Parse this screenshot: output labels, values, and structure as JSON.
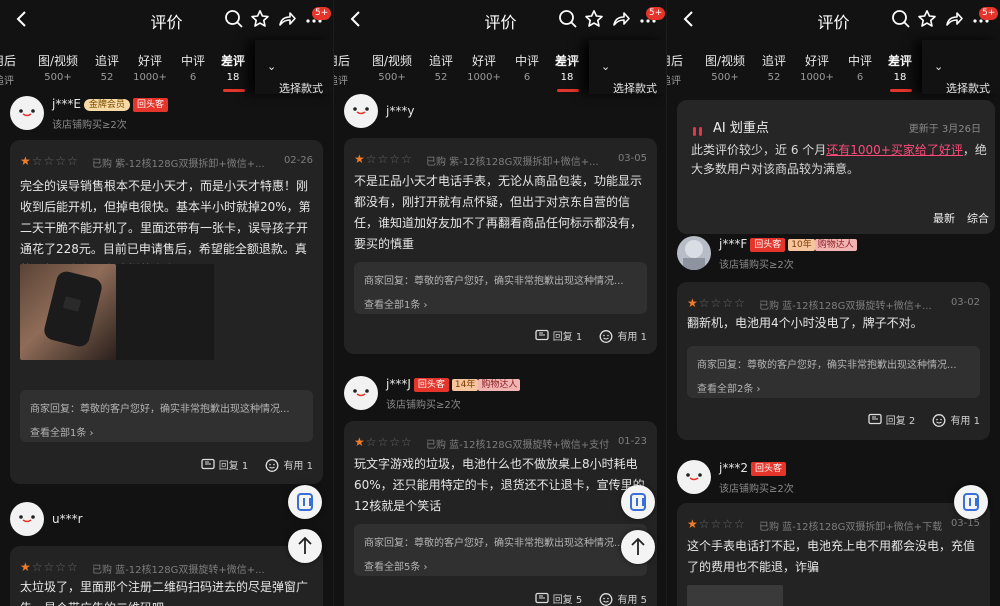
{
  "header": {
    "title": "评价",
    "badge": "5+"
  },
  "tabs": [
    {
      "label": "用后",
      "count": "追评"
    },
    {
      "label": "图/视频",
      "count": "500+"
    },
    {
      "label": "追评",
      "count": "52"
    },
    {
      "label": "好评",
      "count": "1000+"
    },
    {
      "label": "中评",
      "count": "6"
    },
    {
      "label": "差评",
      "count": "18"
    }
  ],
  "style_select": "选择款式",
  "common": {
    "merchant_reply": "商家回复：尊敬的客户您好，确实非常抱歉出现这种情况...",
    "reply_label": "回复",
    "useful_label": "有用"
  },
  "panel1": {
    "top_user": {
      "name": "j***E",
      "gold_tag": "金牌会员",
      "repeat_tag": "回头客",
      "meta": "该店铺购买≥2次"
    },
    "review": {
      "bought": "已购 紫-12核128G双摄拆卸+微信+...",
      "date": "02-26",
      "text": "完全的误导销售根本不是小天才，而是小天才特惠！刚收到后能开机，但掉电很快。基本半小时就掉20%，第二天干脆不能开机了。里面还带有一张卡，误导孩子开通花了228元。目前已申请售后，希望能全额退款。真的没想到京东还有这样的商家",
      "view_all": "查看全部1条",
      "reply_count": "1",
      "useful_count": "1"
    },
    "user2": {
      "name": "u***r"
    },
    "review2": {
      "bought": "已购 蓝-12核128G双摄旋转+微信+...",
      "date": "",
      "text": "太垃圾了，里面那个注册二维码扫码进去的尽是弹窗广告，是个带广告的二维码吧"
    }
  },
  "panel2": {
    "top_user": {
      "name": "j***y"
    },
    "review": {
      "bought": "已购 紫-12核128G双摄拆卸+微信+...",
      "date": "03-05",
      "text": "不是正品小天才电话手表，无论从商品包装，功能显示都没有，刚打开就有点怀疑，但出于对京东自营的信任，谁知道加好友加不了再翻看商品任何标示都没有，要买的慎重",
      "view_all": "查看全部1条",
      "reply_count": "1",
      "useful_count": "1"
    },
    "user2": {
      "name": "j***J",
      "repeat_tag": "回头客",
      "year_tag": "14年",
      "buyer_tag": "购物达人",
      "meta": "该店铺购买≥2次"
    },
    "review2": {
      "bought": "已购 蓝-12核128G双摄旋转+微信+支付",
      "date": "01-23",
      "text": "玩文字游戏的垃圾，电池什么也不做放桌上8小时耗电60%，还只能用特定的卡，退货还不让退卡，宣传里的12核就是个笑话",
      "view_all": "查看全部5条",
      "reply_count": "5",
      "useful_count": "5"
    }
  },
  "panel3": {
    "ai": {
      "title": "AI 划重点",
      "updated": "更新于 3月26日",
      "text_pre": "此类评价较少，近 6 个月",
      "text_hl": "还有1000+买家给了好评",
      "text_post": "，绝大多数用户对该商品较为满意。",
      "sort_latest": "最新",
      "sort_overall": "综合"
    },
    "user1": {
      "name": "j***F",
      "repeat_tag": "回头客",
      "year_tag": "10年",
      "buyer_tag": "购物达人",
      "meta": "该店铺购买≥2次"
    },
    "review": {
      "bought": "已购 蓝-12核128G双摄旋转+微信+...",
      "date": "03-02",
      "text": "翻新机，电池用4个小时没电了，牌子不对。",
      "view_all": "查看全部2条",
      "reply_count": "2",
      "useful_count": "1"
    },
    "user2": {
      "name": "j***2",
      "repeat_tag": "回头客",
      "meta": "该店铺购买≥2次"
    },
    "review2": {
      "bought": "已购 蓝-12核128G双摄拆卸+微信+下载",
      "date": "03-15",
      "text": "这个手表电话打不起，电池充上电不用都会没电，充值了的费用也不能退，诈骗"
    }
  }
}
